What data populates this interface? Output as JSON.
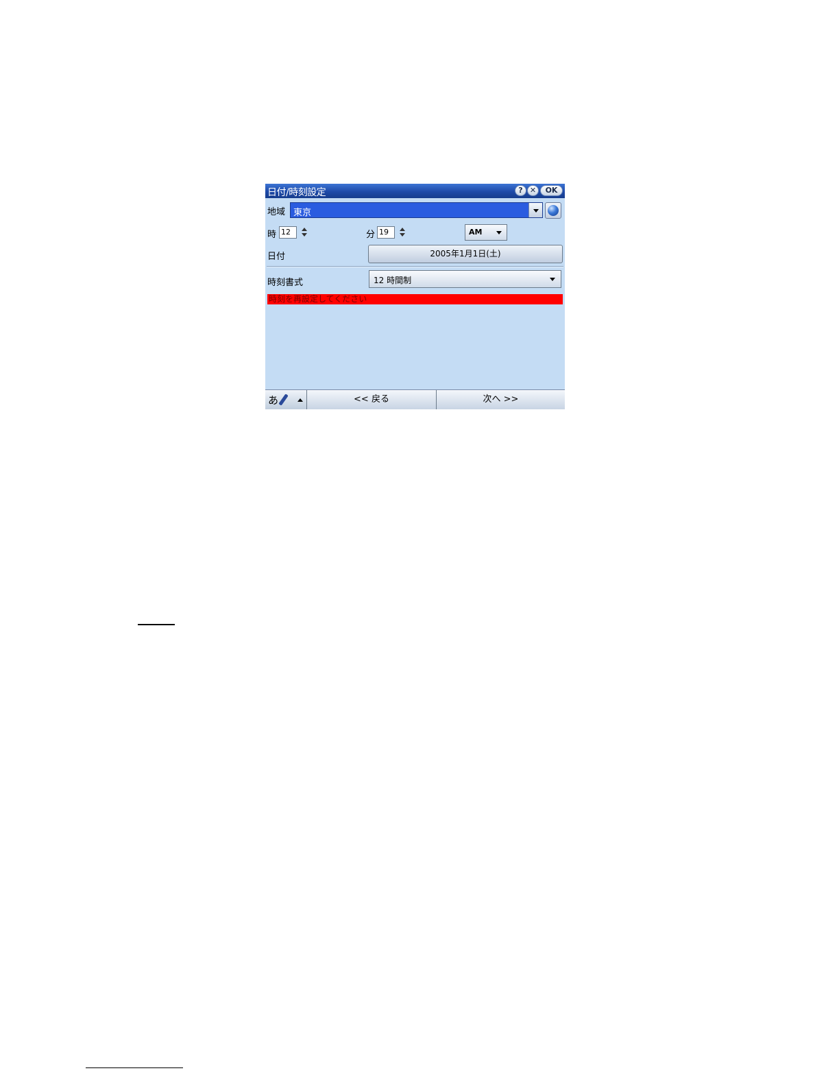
{
  "window": {
    "title": "日付/時刻設定",
    "help_label": "?",
    "close_label": "✕",
    "ok_label": "OK"
  },
  "region": {
    "label": "地域",
    "value": "東京"
  },
  "time": {
    "hour_label": "時",
    "hour_value": "12",
    "minute_label": "分",
    "minute_value": "19",
    "ampm_value": "AM"
  },
  "date": {
    "label": "日付",
    "value": "2005年1月1日(土)"
  },
  "format": {
    "label": "時刻書式",
    "value": "12 時間制"
  },
  "alert": {
    "message": "時刻を再設定してください"
  },
  "bottombar": {
    "ime_label": "あ",
    "back_label": "<< 戻る",
    "next_label": "次へ >>"
  },
  "colors": {
    "screen_bg": "#c4dcf4",
    "title_bg": "#1e4aa8",
    "alert_bg": "#ff0000",
    "select_highlight": "#2a5ce0"
  }
}
